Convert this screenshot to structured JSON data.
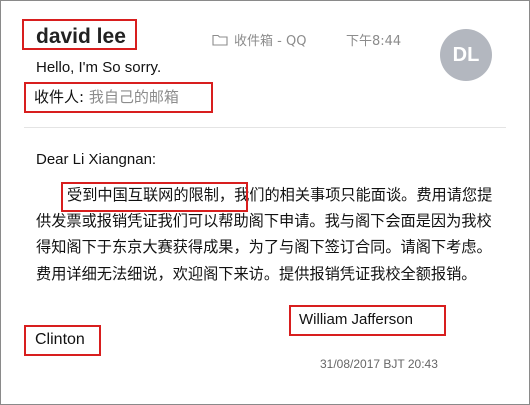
{
  "email": {
    "sender": "david lee",
    "folder": "收件箱 - QQ",
    "time": "下午8:44",
    "avatar_initials": "DL",
    "subject": "Hello, I'm So sorry.",
    "recipient_label": "收件人:",
    "recipient_value": "我自己的邮箱",
    "greeting": "Dear Li Xiangnan:",
    "body_highlight": "受到中国互联网的限制",
    "body_rest": "，我们的相关事项只能面谈。费用请您提供发票或报销凭证我们可以帮助阁下申请。我与阁下会面是因为我校得知阁下于东京大赛获得成果，为了与阁下签订合同。请阁下考虑。费用详细无法细说，欢迎阁下来访。提供报销凭证我校全额报销。",
    "signature": "William Jafferson",
    "closing": "Clinton",
    "datetime": "31/08/2017 BJT 20:43"
  },
  "colors": {
    "highlight_border": "#d81e1e",
    "avatar_bg": "#b3b7bf",
    "muted_text": "#8c8c8c"
  },
  "icons": {
    "folder": "folder-icon"
  }
}
